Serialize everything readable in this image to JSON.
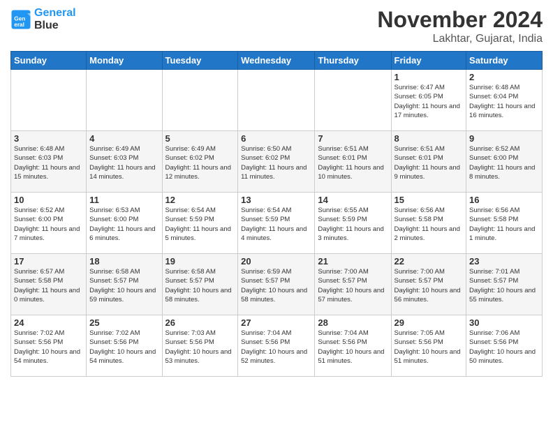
{
  "header": {
    "logo_text1": "General",
    "logo_text2": "Blue",
    "month_title": "November 2024",
    "location": "Lakhtar, Gujarat, India"
  },
  "weekdays": [
    "Sunday",
    "Monday",
    "Tuesday",
    "Wednesday",
    "Thursday",
    "Friday",
    "Saturday"
  ],
  "weeks": [
    [
      {
        "day": "",
        "info": ""
      },
      {
        "day": "",
        "info": ""
      },
      {
        "day": "",
        "info": ""
      },
      {
        "day": "",
        "info": ""
      },
      {
        "day": "",
        "info": ""
      },
      {
        "day": "1",
        "info": "Sunrise: 6:47 AM\nSunset: 6:05 PM\nDaylight: 11 hours and 17 minutes."
      },
      {
        "day": "2",
        "info": "Sunrise: 6:48 AM\nSunset: 6:04 PM\nDaylight: 11 hours and 16 minutes."
      }
    ],
    [
      {
        "day": "3",
        "info": "Sunrise: 6:48 AM\nSunset: 6:03 PM\nDaylight: 11 hours and 15 minutes."
      },
      {
        "day": "4",
        "info": "Sunrise: 6:49 AM\nSunset: 6:03 PM\nDaylight: 11 hours and 14 minutes."
      },
      {
        "day": "5",
        "info": "Sunrise: 6:49 AM\nSunset: 6:02 PM\nDaylight: 11 hours and 12 minutes."
      },
      {
        "day": "6",
        "info": "Sunrise: 6:50 AM\nSunset: 6:02 PM\nDaylight: 11 hours and 11 minutes."
      },
      {
        "day": "7",
        "info": "Sunrise: 6:51 AM\nSunset: 6:01 PM\nDaylight: 11 hours and 10 minutes."
      },
      {
        "day": "8",
        "info": "Sunrise: 6:51 AM\nSunset: 6:01 PM\nDaylight: 11 hours and 9 minutes."
      },
      {
        "day": "9",
        "info": "Sunrise: 6:52 AM\nSunset: 6:00 PM\nDaylight: 11 hours and 8 minutes."
      }
    ],
    [
      {
        "day": "10",
        "info": "Sunrise: 6:52 AM\nSunset: 6:00 PM\nDaylight: 11 hours and 7 minutes."
      },
      {
        "day": "11",
        "info": "Sunrise: 6:53 AM\nSunset: 6:00 PM\nDaylight: 11 hours and 6 minutes."
      },
      {
        "day": "12",
        "info": "Sunrise: 6:54 AM\nSunset: 5:59 PM\nDaylight: 11 hours and 5 minutes."
      },
      {
        "day": "13",
        "info": "Sunrise: 6:54 AM\nSunset: 5:59 PM\nDaylight: 11 hours and 4 minutes."
      },
      {
        "day": "14",
        "info": "Sunrise: 6:55 AM\nSunset: 5:59 PM\nDaylight: 11 hours and 3 minutes."
      },
      {
        "day": "15",
        "info": "Sunrise: 6:56 AM\nSunset: 5:58 PM\nDaylight: 11 hours and 2 minutes."
      },
      {
        "day": "16",
        "info": "Sunrise: 6:56 AM\nSunset: 5:58 PM\nDaylight: 11 hours and 1 minute."
      }
    ],
    [
      {
        "day": "17",
        "info": "Sunrise: 6:57 AM\nSunset: 5:58 PM\nDaylight: 11 hours and 0 minutes."
      },
      {
        "day": "18",
        "info": "Sunrise: 6:58 AM\nSunset: 5:57 PM\nDaylight: 10 hours and 59 minutes."
      },
      {
        "day": "19",
        "info": "Sunrise: 6:58 AM\nSunset: 5:57 PM\nDaylight: 10 hours and 58 minutes."
      },
      {
        "day": "20",
        "info": "Sunrise: 6:59 AM\nSunset: 5:57 PM\nDaylight: 10 hours and 58 minutes."
      },
      {
        "day": "21",
        "info": "Sunrise: 7:00 AM\nSunset: 5:57 PM\nDaylight: 10 hours and 57 minutes."
      },
      {
        "day": "22",
        "info": "Sunrise: 7:00 AM\nSunset: 5:57 PM\nDaylight: 10 hours and 56 minutes."
      },
      {
        "day": "23",
        "info": "Sunrise: 7:01 AM\nSunset: 5:57 PM\nDaylight: 10 hours and 55 minutes."
      }
    ],
    [
      {
        "day": "24",
        "info": "Sunrise: 7:02 AM\nSunset: 5:56 PM\nDaylight: 10 hours and 54 minutes."
      },
      {
        "day": "25",
        "info": "Sunrise: 7:02 AM\nSunset: 5:56 PM\nDaylight: 10 hours and 54 minutes."
      },
      {
        "day": "26",
        "info": "Sunrise: 7:03 AM\nSunset: 5:56 PM\nDaylight: 10 hours and 53 minutes."
      },
      {
        "day": "27",
        "info": "Sunrise: 7:04 AM\nSunset: 5:56 PM\nDaylight: 10 hours and 52 minutes."
      },
      {
        "day": "28",
        "info": "Sunrise: 7:04 AM\nSunset: 5:56 PM\nDaylight: 10 hours and 51 minutes."
      },
      {
        "day": "29",
        "info": "Sunrise: 7:05 AM\nSunset: 5:56 PM\nDaylight: 10 hours and 51 minutes."
      },
      {
        "day": "30",
        "info": "Sunrise: 7:06 AM\nSunset: 5:56 PM\nDaylight: 10 hours and 50 minutes."
      }
    ]
  ]
}
